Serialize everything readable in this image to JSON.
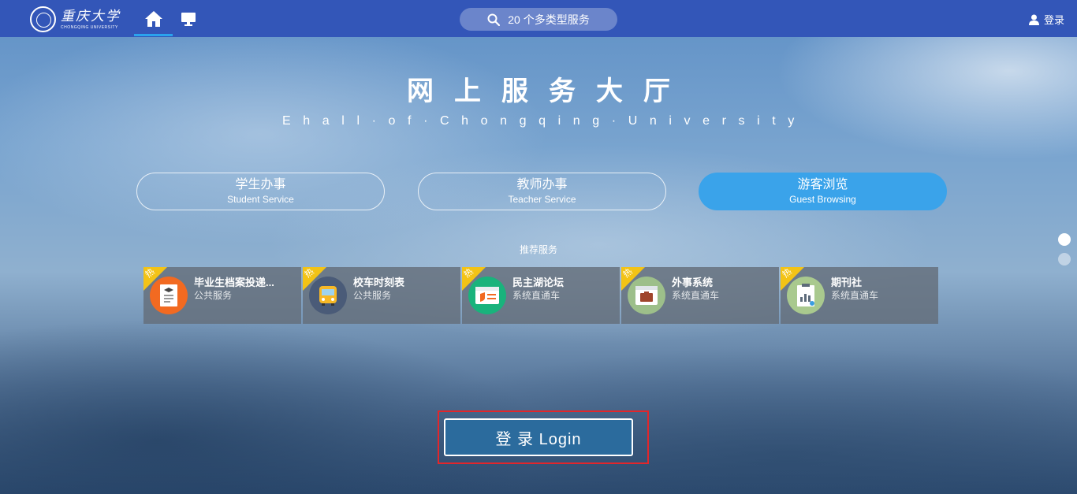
{
  "header": {
    "logo_cn": "重庆大学",
    "logo_en": "CHONGQING UNIVERSITY",
    "search_label": "20 个多类型服务",
    "login_label": "登录"
  },
  "hero": {
    "title": "网上服务大厅",
    "subtitle": "Ehall·of·Chongqing·University"
  },
  "roles": [
    {
      "cn": "学生办事",
      "en": "Student Service",
      "active": false
    },
    {
      "cn": "教师办事",
      "en": "Teacher Service",
      "active": false
    },
    {
      "cn": "游客浏览",
      "en": "Guest Browsing",
      "active": true
    }
  ],
  "recommended": {
    "title": "推荐服务",
    "badge": "热",
    "items": [
      {
        "name": "毕业生档案投递...",
        "category": "公共服务",
        "icon": "document-icon",
        "color": "#f26a21"
      },
      {
        "name": "校车时刻表",
        "category": "公共服务",
        "icon": "bus-icon",
        "color": "#4a5b78"
      },
      {
        "name": "民主湖论坛",
        "category": "系统直通车",
        "icon": "forum-icon",
        "color": "#19b37c"
      },
      {
        "name": "外事系统",
        "category": "系统直通车",
        "icon": "briefcase-icon",
        "color": "#9dbf8a"
      },
      {
        "name": "期刊社",
        "category": "系统直通车",
        "icon": "journal-icon",
        "color": "#a9c98e"
      }
    ]
  },
  "login_button": "登 录 Login",
  "colors": {
    "topbar": "#3356b8",
    "accent": "#3aa3ea",
    "hot": "#f3c316",
    "highlight_frame": "#e2262b"
  }
}
